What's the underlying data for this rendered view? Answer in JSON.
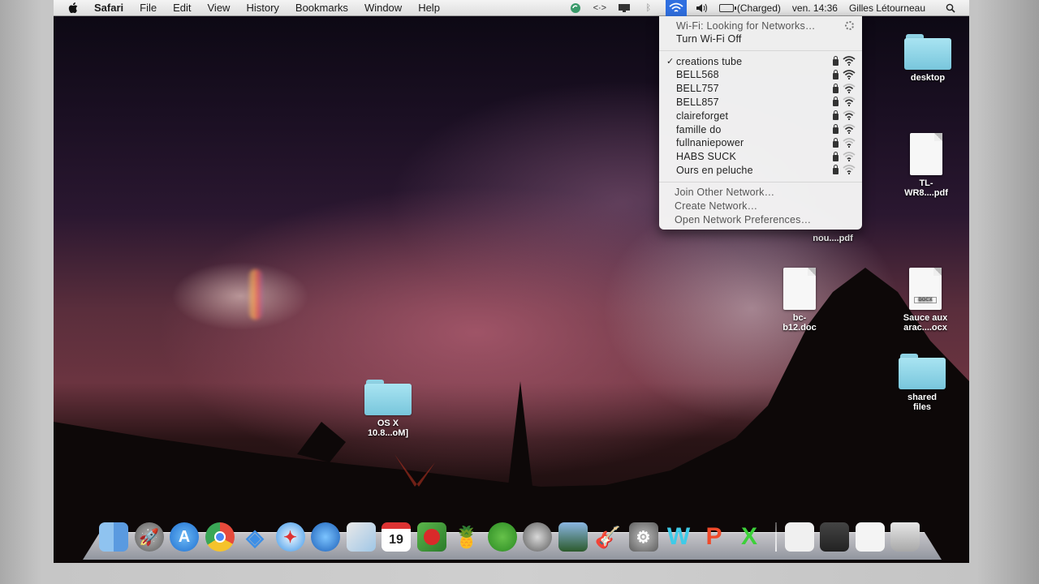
{
  "menubar": {
    "app_name": "Safari",
    "menus": [
      "File",
      "Edit",
      "View",
      "History",
      "Bookmarks",
      "Window",
      "Help"
    ],
    "battery_status": "(Charged)",
    "clock": "ven. 14:36",
    "user": "Gilles Létourneau"
  },
  "wifi_menu": {
    "status": "Wi-Fi: Looking for Networks…",
    "toggle": "Turn Wi-Fi Off",
    "connected": "creations tube",
    "networks": [
      {
        "name": "creations tube",
        "bars": 4
      },
      {
        "name": "BELL568",
        "bars": 4
      },
      {
        "name": "BELL757",
        "bars": 3
      },
      {
        "name": "BELL857",
        "bars": 3
      },
      {
        "name": "claireforget",
        "bars": 3
      },
      {
        "name": "famille do",
        "bars": 3
      },
      {
        "name": "fullnaniepower",
        "bars": 2
      },
      {
        "name": "HABS SUCK",
        "bars": 2
      },
      {
        "name": "Ours en peluche",
        "bars": 1
      }
    ],
    "join_other": "Join Other Network…",
    "create": "Create Network…",
    "preferences": "Open Network Preferences…"
  },
  "desktop_icons": {
    "desktop_folder": "desktop",
    "tl_pdf": [
      "TL-",
      "WR8....pdf"
    ],
    "nou_pdf": "nou....pdf",
    "bc_doc": [
      "bc-",
      "b12.doc"
    ],
    "sauce_doc": [
      "Sauce aux",
      "arac....ocx"
    ],
    "shared_folder": [
      "shared",
      "files"
    ],
    "osx_folder": [
      "OS X",
      "10.8...oM]"
    ],
    "doc_tag": "DOCX"
  },
  "dock": {
    "items": [
      "finder-icon",
      "launchpad-icon",
      "app-store-icon",
      "chrome-icon",
      "dropbox-icon",
      "safari-icon",
      "google-earth-icon",
      "preview-icon",
      "calendar-icon",
      "angry-birds-icon",
      "pinata-icon",
      "adium-icon",
      "time-machine-icon",
      "iphoto-icon",
      "garageband-icon",
      "system-preferences-icon",
      "word-icon",
      "powerpoint-icon",
      "excel-icon"
    ],
    "calendar_day": "19",
    "stack_items": [
      "documents-stack-icon",
      "downloads-stack-icon",
      "file-stack-icon",
      "trash-icon"
    ]
  },
  "colors": {
    "menu_highlight": "#2f6fe0",
    "folder": "#8fd2e4"
  }
}
